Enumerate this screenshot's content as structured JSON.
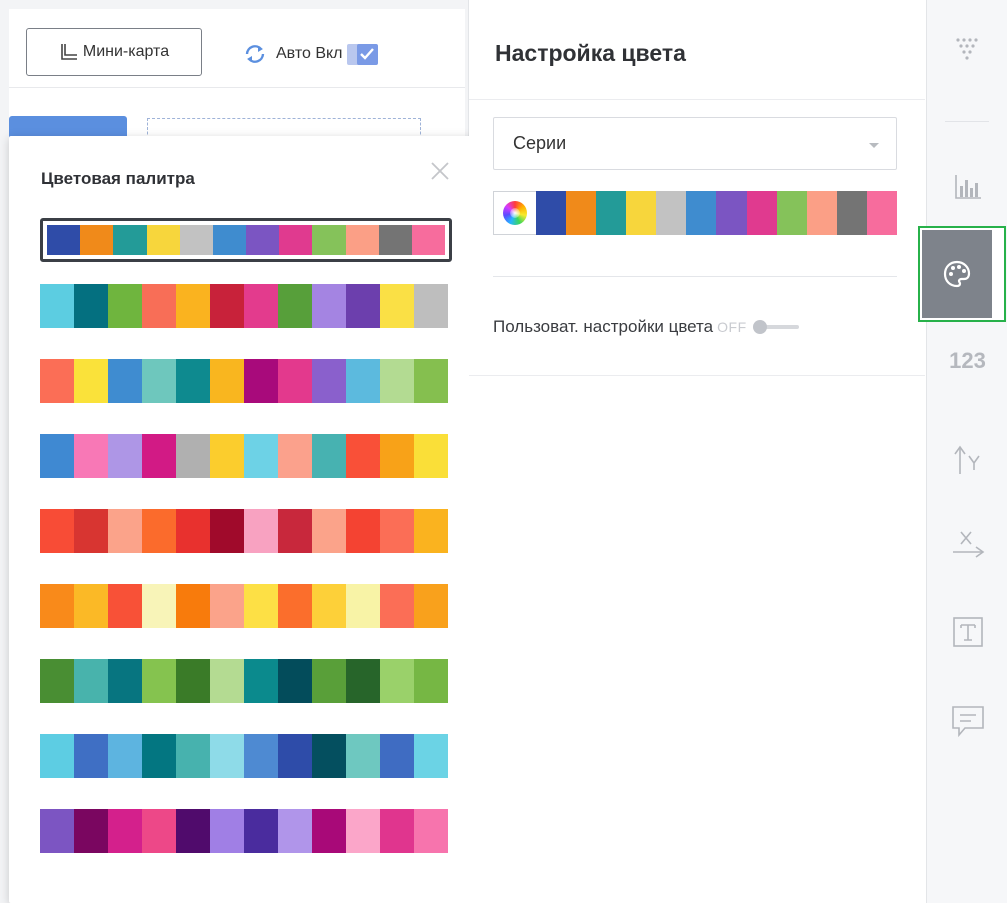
{
  "toolbar": {
    "minimap_label": "Мини-карта",
    "auto_label": "Авто Вкл",
    "auto_checked": true
  },
  "palette_panel": {
    "title": "Цветовая палитра",
    "selected_index": 0,
    "palettes": [
      [
        "#2f4ca8",
        "#f08a1a",
        "#239b98",
        "#f7d63c",
        "#c2c2c2",
        "#3f8ccf",
        "#7b55c2",
        "#e03a8f",
        "#85c25a",
        "#fb9f86",
        "#747474",
        "#f76c9d"
      ],
      [
        "#5ccde1",
        "#047080",
        "#6fb53e",
        "#f86e57",
        "#fab31f",
        "#c8223a",
        "#e33b8d",
        "#579f3a",
        "#a484e2",
        "#6c3fad",
        "#fae045",
        "#bebebe"
      ],
      [
        "#fb6e56",
        "#fae23a",
        "#3f8cd0",
        "#6ec7bd",
        "#0e8a8f",
        "#f9b61f",
        "#a80a7b",
        "#e3398d",
        "#8a60cc",
        "#5cbade",
        "#b3db92",
        "#85bf4f"
      ],
      [
        "#3f89d2",
        "#f878b6",
        "#ae96e6",
        "#d21a85",
        "#b0b0b0",
        "#fbcd2d",
        "#6dd2e6",
        "#fba18c",
        "#47b2b1",
        "#f95038",
        "#f8a218",
        "#fadf38"
      ],
      [
        "#f84c36",
        "#d83531",
        "#fba38a",
        "#fb6b2c",
        "#e8312e",
        "#a00a2b",
        "#f8a2c1",
        "#c8283c",
        "#fba38a",
        "#f44332",
        "#fb6e56",
        "#fab31f"
      ],
      [
        "#f98a1a",
        "#fbb926",
        "#f85137",
        "#f8f4b8",
        "#f87b0c",
        "#fba38a",
        "#fde045",
        "#fb6e2c",
        "#fdd039",
        "#f8f3a6",
        "#fb6e56",
        "#f9a11c"
      ],
      [
        "#498e33",
        "#48b3ac",
        "#077580",
        "#85c34f",
        "#3a7b28",
        "#b4db92",
        "#0b8a8d",
        "#034c5b",
        "#599f39",
        "#27652a",
        "#9ad16a",
        "#76b744"
      ],
      [
        "#5dcde3",
        "#3f6fc4",
        "#5db4e0",
        "#037681",
        "#47b2ae",
        "#8edbe8",
        "#4e8ad2",
        "#2e4ca9",
        "#044f5f",
        "#6ec8c0",
        "#3f6cc2",
        "#6bd3e5"
      ],
      [
        "#7c55c2",
        "#7a0660",
        "#d4208c",
        "#ed4888",
        "#500b6c",
        "#a07fe5",
        "#4a2c9e",
        "#b095ea",
        "#a80978",
        "#fba6c9",
        "#e0358e",
        "#f774ad"
      ]
    ]
  },
  "settings": {
    "title": "Настройка цвета",
    "series_select_value": "Серии",
    "current_colors": [
      "#2f4ca8",
      "#f08a1a",
      "#239b98",
      "#f7d63c",
      "#c2c2c2",
      "#3f8ccf",
      "#7b55c2",
      "#e03a8f",
      "#85c25a",
      "#fb9f86",
      "#747474",
      "#f76c9d"
    ],
    "custom_color_label": "Пользоват. настройки цвета",
    "custom_color_state": "OFF"
  },
  "rail": {
    "number_label": "123",
    "active_color": "#27b14a"
  }
}
